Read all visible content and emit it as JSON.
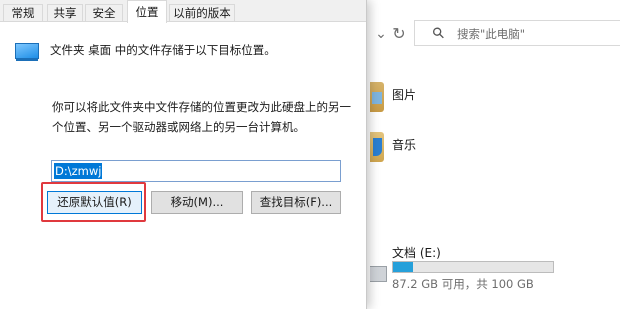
{
  "dialog": {
    "tabs": [
      {
        "label": "常规"
      },
      {
        "label": "共享"
      },
      {
        "label": "安全"
      },
      {
        "label": "位置",
        "active": true
      },
      {
        "label": "以前的版本"
      }
    ],
    "info_text": "文件夹 桌面 中的文件存储于以下目标位置。",
    "description": "你可以将此文件夹中文件存储的位置更改为此硬盘上的另一个位置、另一个驱动器或网络上的另一台计算机。",
    "path_value": "D:\\zmwj",
    "buttons": {
      "restore": "还原默认值(R)",
      "move": "移动(M)...",
      "find": "查找目标(F)..."
    },
    "highlight_color": "#e0393e"
  },
  "explorer": {
    "refresh_icon": "refresh-icon",
    "search_placeholder": "搜索\"此电脑\"",
    "folders": [
      {
        "label": "图片",
        "icon": "pictures-folder-icon"
      },
      {
        "label": "音乐",
        "icon": "music-folder-icon"
      }
    ],
    "drive": {
      "name": "文档 (E:)",
      "free_text": "87.2 GB 可用，共 100 GB",
      "used_fraction": 0.128,
      "bar_color": "#26a0da"
    }
  }
}
